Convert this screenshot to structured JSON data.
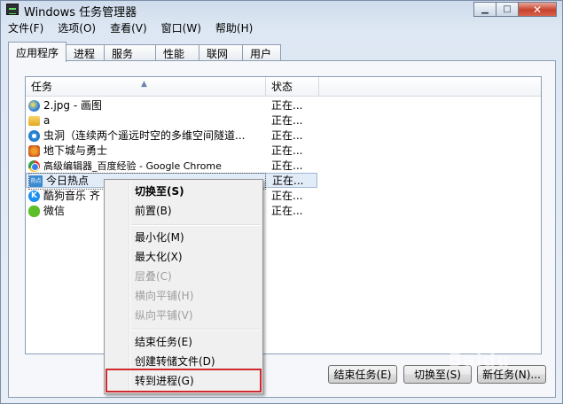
{
  "window": {
    "title": "Windows 任务管理器",
    "controls": {
      "minimize": "▁",
      "maximize": "□",
      "close": "✕"
    }
  },
  "menu": [
    "文件(F)",
    "选项(O)",
    "查看(V)",
    "窗口(W)",
    "帮助(H)"
  ],
  "tabs": [
    "应用程序",
    "进程",
    "服务",
    "性能",
    "联网",
    "用户"
  ],
  "table": {
    "columns": {
      "task": "任务",
      "status": "状态"
    },
    "rows": [
      {
        "icon": "paint-icon",
        "task": "2.jpg - 画图",
        "status": "正在..."
      },
      {
        "icon": "folder-icon",
        "task": "a",
        "status": "正在..."
      },
      {
        "icon": "ie-icon",
        "task": "虫洞（连续两个遥远时空的多维空间隧道...",
        "status": "正在..."
      },
      {
        "icon": "game-icon",
        "task": "地下城与勇士",
        "status": "正在..."
      },
      {
        "icon": "chrome-icon",
        "task": "高级编辑器_百度经验 - Google Chrome",
        "status": "正在..."
      },
      {
        "icon": "news-icon",
        "task": "今日热点",
        "status": "正在..."
      },
      {
        "icon": "kugou-icon",
        "task": "酷狗音乐 齐",
        "status": "正在..."
      },
      {
        "icon": "wechat-icon",
        "task": "微信",
        "status": "正在..."
      }
    ],
    "icon_text": {
      "news": "热点",
      "kugou": "K"
    }
  },
  "context_menu": {
    "switch_to": "切换至(S)",
    "bring_to_front": "前置(B)",
    "minimize": "最小化(M)",
    "maximize": "最大化(X)",
    "cascade": "层叠(C)",
    "tile_horizontal": "横向平铺(H)",
    "tile_vertical": "纵向平铺(V)",
    "end_task": "结束任务(E)",
    "create_dump": "创建转储文件(D)",
    "go_to_process": "转到进程(G)"
  },
  "buttons": {
    "end_task": "结束任务(E)",
    "switch_to": "切换至(S)",
    "new_task": "新任务(N)..."
  },
  "watermark": "Baidu",
  "colors": {
    "highlight_box": "#d0282c"
  }
}
